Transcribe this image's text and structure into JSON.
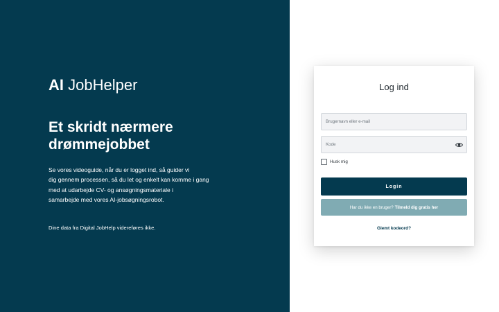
{
  "brand": {
    "logo_ai": "AI",
    "logo_rest": "JobHelper"
  },
  "hero": {
    "headline_line1": "Et skridt nærmere",
    "headline_line2": "drømmejobbet",
    "description_lines": [
      "Se vores videoguide, når du er logget ind, så guider vi",
      "dig gennem processen, så du let og enkelt kan komme i gang",
      "med at udarbejde CV- og ansøgningsmateriale i",
      "samarbejde med vores AI-jobsøgningsrobot."
    ],
    "note": "Dine data fra Digital JobHelp videreføres ikke."
  },
  "login": {
    "title": "Log ind",
    "username_placeholder": "Brugernavn eller e-mail",
    "username_value": "",
    "password_placeholder": "Kode",
    "password_value": "",
    "remember_label": "Husk mig",
    "remember_checked": false,
    "login_button": "Login",
    "signup_prompt": "Har du ikke en bruger?",
    "signup_link": "Tilmeld dig gratis her",
    "forgot_link": "Glemt kodeord?",
    "password_toggle_icon": "eye-icon"
  },
  "colors": {
    "primary": "#043a4f",
    "secondary_button": "#80abb3",
    "field_bg": "#f2f3f5",
    "page_bg": "#ffffff"
  }
}
